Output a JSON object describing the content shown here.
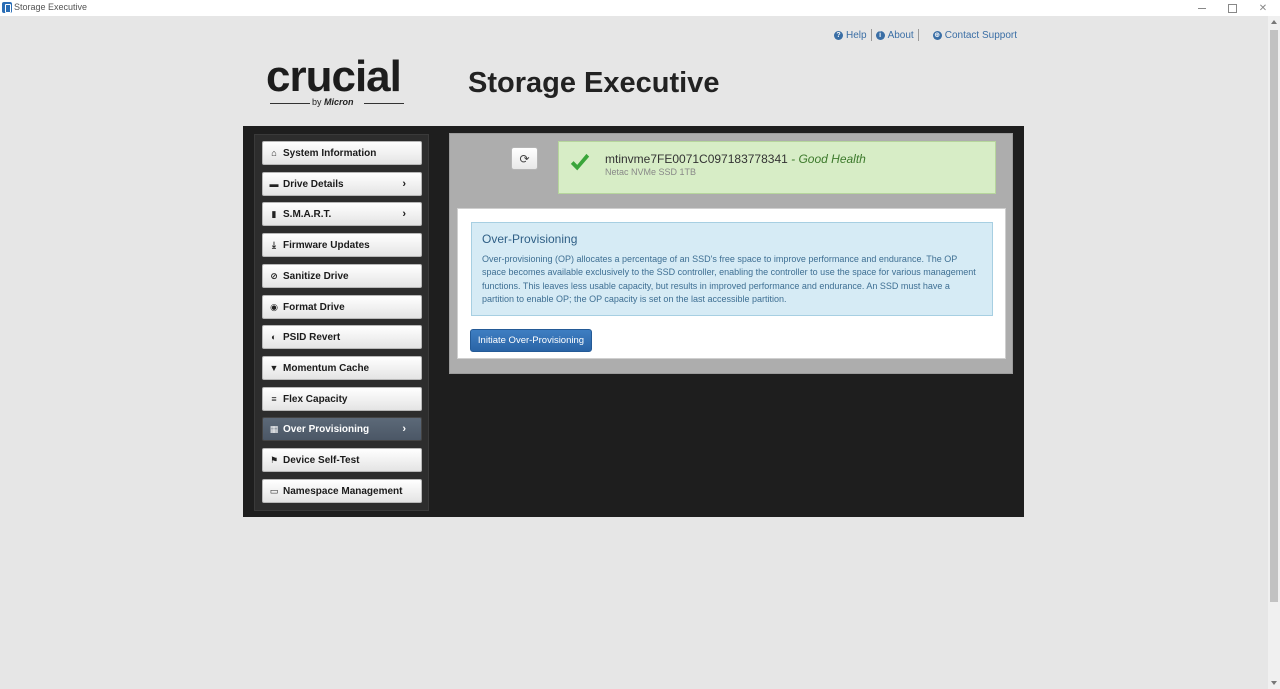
{
  "window": {
    "title": "Storage Executive"
  },
  "top_links": {
    "help": "Help",
    "about": "About",
    "contact": "Contact Support"
  },
  "logo": {
    "word": "crucial",
    "by": "by",
    "brand": "Micron"
  },
  "header": {
    "title": "Storage Executive"
  },
  "sidebar": {
    "items": [
      {
        "label": "System Information",
        "icon": "home-icon",
        "arrow": false,
        "active": false
      },
      {
        "label": "Drive Details",
        "icon": "drive-icon",
        "arrow": true,
        "active": false
      },
      {
        "label": "S.M.A.R.T.",
        "icon": "bar-chart-icon",
        "arrow": true,
        "active": false
      },
      {
        "label": "Firmware Updates",
        "icon": "download-icon",
        "arrow": false,
        "active": false
      },
      {
        "label": "Sanitize Drive",
        "icon": "ban-icon",
        "arrow": false,
        "active": false
      },
      {
        "label": "Format Drive",
        "icon": "disc-icon",
        "arrow": false,
        "active": false
      },
      {
        "label": "PSID Revert",
        "icon": "eye-slash-icon",
        "arrow": false,
        "active": false
      },
      {
        "label": "Momentum Cache",
        "icon": "filter-icon",
        "arrow": false,
        "active": false
      },
      {
        "label": "Flex Capacity",
        "icon": "align-left-icon",
        "arrow": false,
        "active": false
      },
      {
        "label": "Over Provisioning",
        "icon": "grid-icon",
        "arrow": true,
        "active": true
      },
      {
        "label": "Device Self-Test",
        "icon": "flag-icon",
        "arrow": false,
        "active": false
      },
      {
        "label": "Namespace Management",
        "icon": "briefcase-icon",
        "arrow": false,
        "active": false
      }
    ]
  },
  "drive": {
    "name": "mtinvme7FE0071C097183778341",
    "health": "- Good Health",
    "model": "Netac NVMe SSD 1TB"
  },
  "over_provisioning": {
    "title": "Over-Provisioning",
    "description": "Over-provisioning (OP) allocates a percentage of an SSD's free space to improve performance and endurance. The OP space becomes available exclusively to the SSD controller, enabling the controller to use the space for various management functions. This leaves less usable capacity, but results in improved performance and endurance. An SSD must have a partition to enable OP; the OP capacity is set on the last accessible partition.",
    "button_label": "Initiate Over-Provisioning"
  },
  "colors": {
    "accent": "#2a64a6",
    "success": "#3d7a2c",
    "panel_dark": "#1e1e1e"
  }
}
